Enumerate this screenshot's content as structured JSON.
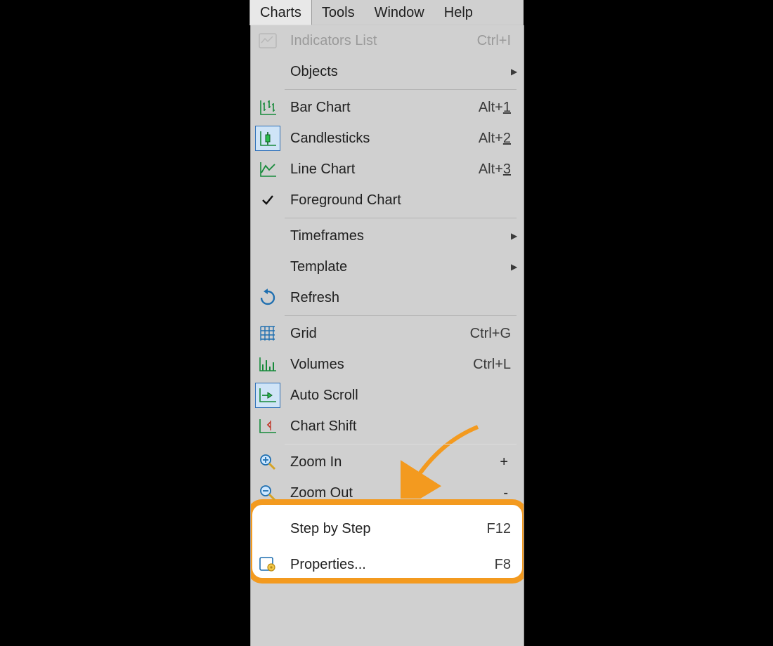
{
  "menubar": {
    "charts": "Charts",
    "tools": "Tools",
    "window": "Window",
    "help": "Help"
  },
  "menu": {
    "indicators": {
      "label": "Indicators List",
      "accel": "Ctrl+I"
    },
    "objects": {
      "label": "Objects"
    },
    "bar": {
      "label": "Bar Chart",
      "accel": "Alt+",
      "accel_u": "1"
    },
    "candles": {
      "label": "Candlesticks",
      "accel": "Alt+",
      "accel_u": "2"
    },
    "line": {
      "label": "Line Chart",
      "accel": "Alt+",
      "accel_u": "3"
    },
    "foreground": {
      "label": "Foreground Chart"
    },
    "timeframes": {
      "label": "Timeframes"
    },
    "template": {
      "label": "Template"
    },
    "refresh": {
      "label": "Refresh"
    },
    "grid": {
      "label": "Grid",
      "accel": "Ctrl+G"
    },
    "volumes": {
      "label": "Volumes",
      "accel": "Ctrl+L"
    },
    "autoscroll": {
      "label": "Auto Scroll"
    },
    "chartshift": {
      "label": "Chart Shift"
    },
    "zoomin": {
      "label": "Zoom In",
      "accel": "+"
    },
    "zoomout": {
      "label": "Zoom Out",
      "accel": "-"
    },
    "step": {
      "label": "Step by Step",
      "accel": "F12"
    },
    "properties": {
      "label": "Properties...",
      "accel": "F8"
    }
  }
}
